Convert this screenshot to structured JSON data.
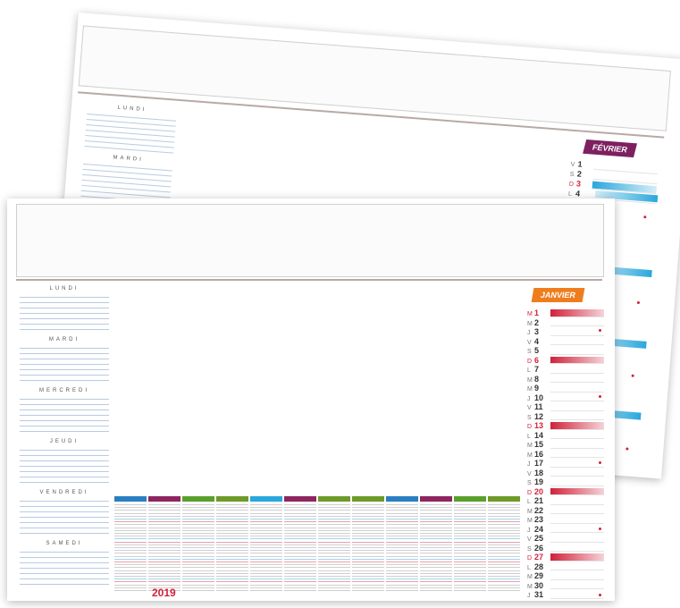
{
  "back_sheet": {
    "days": [
      "LUNDI",
      "MARDI"
    ],
    "calendar": {
      "month": "FÉVRIER",
      "header_color": "#7d2060",
      "band_color": "#2aa7dc",
      "days": [
        {
          "wd": "V",
          "num": "1",
          "red": false
        },
        {
          "wd": "S",
          "num": "2",
          "red": false
        },
        {
          "wd": "D",
          "num": "3",
          "red": true
        },
        {
          "wd": "L",
          "num": "4",
          "red": false
        }
      ]
    }
  },
  "front_sheet": {
    "days": [
      "LUNDI",
      "MARDI",
      "MERCREDI",
      "JEUDI",
      "VENDREDI",
      "SAMEDI"
    ],
    "calendar": {
      "month": "JANVIER",
      "header_color": "#ef7d1e",
      "band_color": "#d0223a",
      "days": [
        {
          "wd": "M",
          "num": "1",
          "red": true
        },
        {
          "wd": "M",
          "num": "2",
          "red": false
        },
        {
          "wd": "J",
          "num": "3",
          "red": false
        },
        {
          "wd": "V",
          "num": "4",
          "red": false
        },
        {
          "wd": "S",
          "num": "5",
          "red": false
        },
        {
          "wd": "D",
          "num": "6",
          "red": true
        },
        {
          "wd": "L",
          "num": "7",
          "red": false
        },
        {
          "wd": "M",
          "num": "8",
          "red": false
        },
        {
          "wd": "M",
          "num": "9",
          "red": false
        },
        {
          "wd": "J",
          "num": "10",
          "red": false
        },
        {
          "wd": "V",
          "num": "11",
          "red": false
        },
        {
          "wd": "S",
          "num": "12",
          "red": false
        },
        {
          "wd": "D",
          "num": "13",
          "red": true
        },
        {
          "wd": "L",
          "num": "14",
          "red": false
        },
        {
          "wd": "M",
          "num": "15",
          "red": false
        },
        {
          "wd": "M",
          "num": "16",
          "red": false
        },
        {
          "wd": "J",
          "num": "17",
          "red": false
        },
        {
          "wd": "V",
          "num": "18",
          "red": false
        },
        {
          "wd": "S",
          "num": "19",
          "red": false
        },
        {
          "wd": "D",
          "num": "20",
          "red": true
        },
        {
          "wd": "L",
          "num": "21",
          "red": false
        },
        {
          "wd": "M",
          "num": "22",
          "red": false
        },
        {
          "wd": "M",
          "num": "23",
          "red": false
        },
        {
          "wd": "J",
          "num": "24",
          "red": false
        },
        {
          "wd": "V",
          "num": "25",
          "red": false
        },
        {
          "wd": "S",
          "num": "26",
          "red": false
        },
        {
          "wd": "D",
          "num": "27",
          "red": true
        },
        {
          "wd": "L",
          "num": "28",
          "red": false
        },
        {
          "wd": "M",
          "num": "29",
          "red": false
        },
        {
          "wd": "M",
          "num": "30",
          "red": false
        },
        {
          "wd": "J",
          "num": "31",
          "red": false
        }
      ]
    },
    "year": "2019",
    "mini_month_colors": [
      "#2a7fc1",
      "#8e2560",
      "#5aa02c",
      "#6e9a2a",
      "#2aa7dc",
      "#8e2560",
      "#6e9a2a",
      "#6e9a2a",
      "#2a7fc1",
      "#8e2560",
      "#5aa02c",
      "#6e9a2a"
    ]
  }
}
